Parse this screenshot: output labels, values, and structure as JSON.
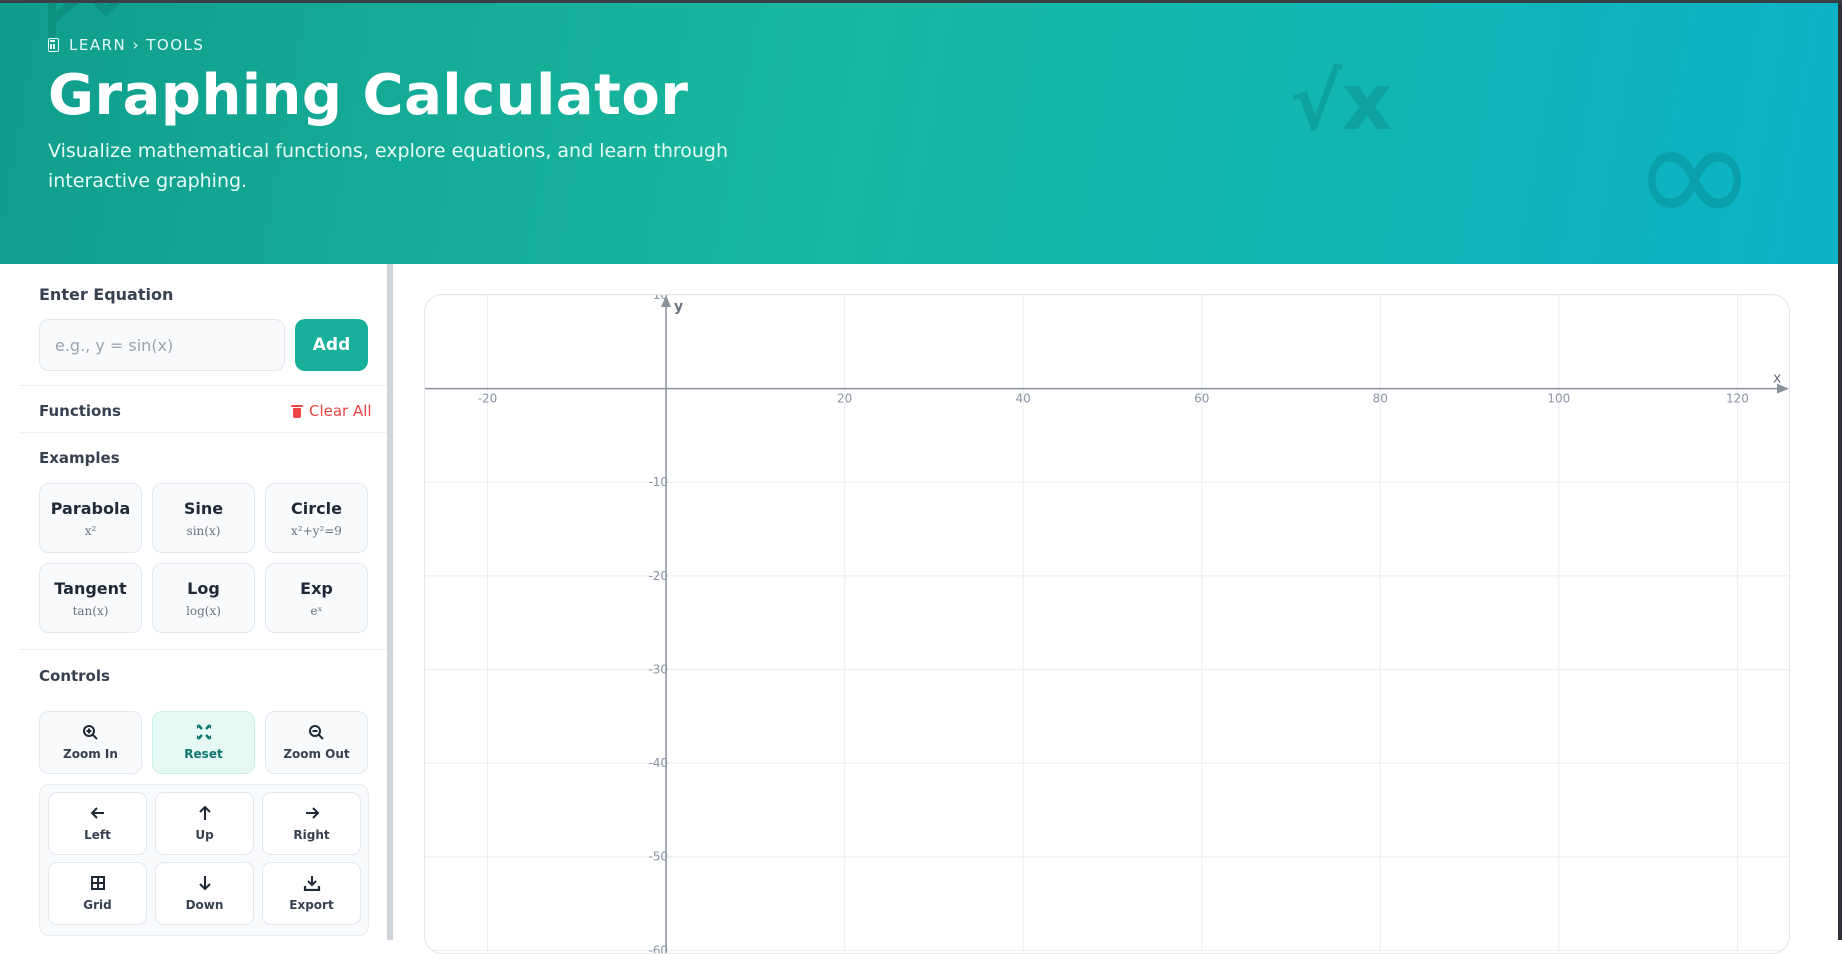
{
  "header": {
    "breadcrumb": "LEARN › TOOLS",
    "title": "Graphing Calculator",
    "subtitle": "Visualize mathematical functions, explore equations, and learn through interactive graphing."
  },
  "equation": {
    "section_title": "Enter Equation",
    "placeholder": "e.g., y = sin(x)",
    "add_label": "Add"
  },
  "functions": {
    "section_title": "Functions",
    "clear_label": "Clear All"
  },
  "examples": {
    "section_title": "Examples",
    "items": [
      {
        "name": "Parabola",
        "formula": "x²"
      },
      {
        "name": "Sine",
        "formula": "sin(x)"
      },
      {
        "name": "Circle",
        "formula": "x²+y²=9"
      },
      {
        "name": "Tangent",
        "formula": "tan(x)"
      },
      {
        "name": "Log",
        "formula": "log(x)"
      },
      {
        "name": "Exp",
        "formula": "eˣ"
      }
    ]
  },
  "controls": {
    "section_title": "Controls",
    "zoom": [
      {
        "label": "Zoom In",
        "icon": "zoom-in-icon"
      },
      {
        "label": "Reset",
        "icon": "reset-icon",
        "active": true
      },
      {
        "label": "Zoom Out",
        "icon": "zoom-out-icon"
      }
    ],
    "nav": [
      {
        "label": "Left",
        "icon": "arrow-left-icon"
      },
      {
        "label": "Up",
        "icon": "arrow-up-icon"
      },
      {
        "label": "Right",
        "icon": "arrow-right-icon"
      },
      {
        "label": "Grid",
        "icon": "grid-icon"
      },
      {
        "label": "Down",
        "icon": "arrow-down-icon"
      },
      {
        "label": "Export",
        "icon": "download-icon"
      }
    ]
  },
  "graph": {
    "x_axis_label": "x",
    "y_axis_label": "y",
    "x_ticks": [
      -20,
      20,
      40,
      60,
      80,
      100,
      120
    ],
    "y_ticks": [
      10,
      -10,
      -20,
      -30,
      -40,
      -50,
      -60
    ],
    "x_range": [
      -27,
      126
    ],
    "y_range": [
      -60.5,
      10
    ],
    "grid": true
  },
  "colors": {
    "accent": "#19b09b",
    "hero_start": "#109e8c",
    "hero_end": "#0ab3c8",
    "danger": "#ef4444"
  }
}
